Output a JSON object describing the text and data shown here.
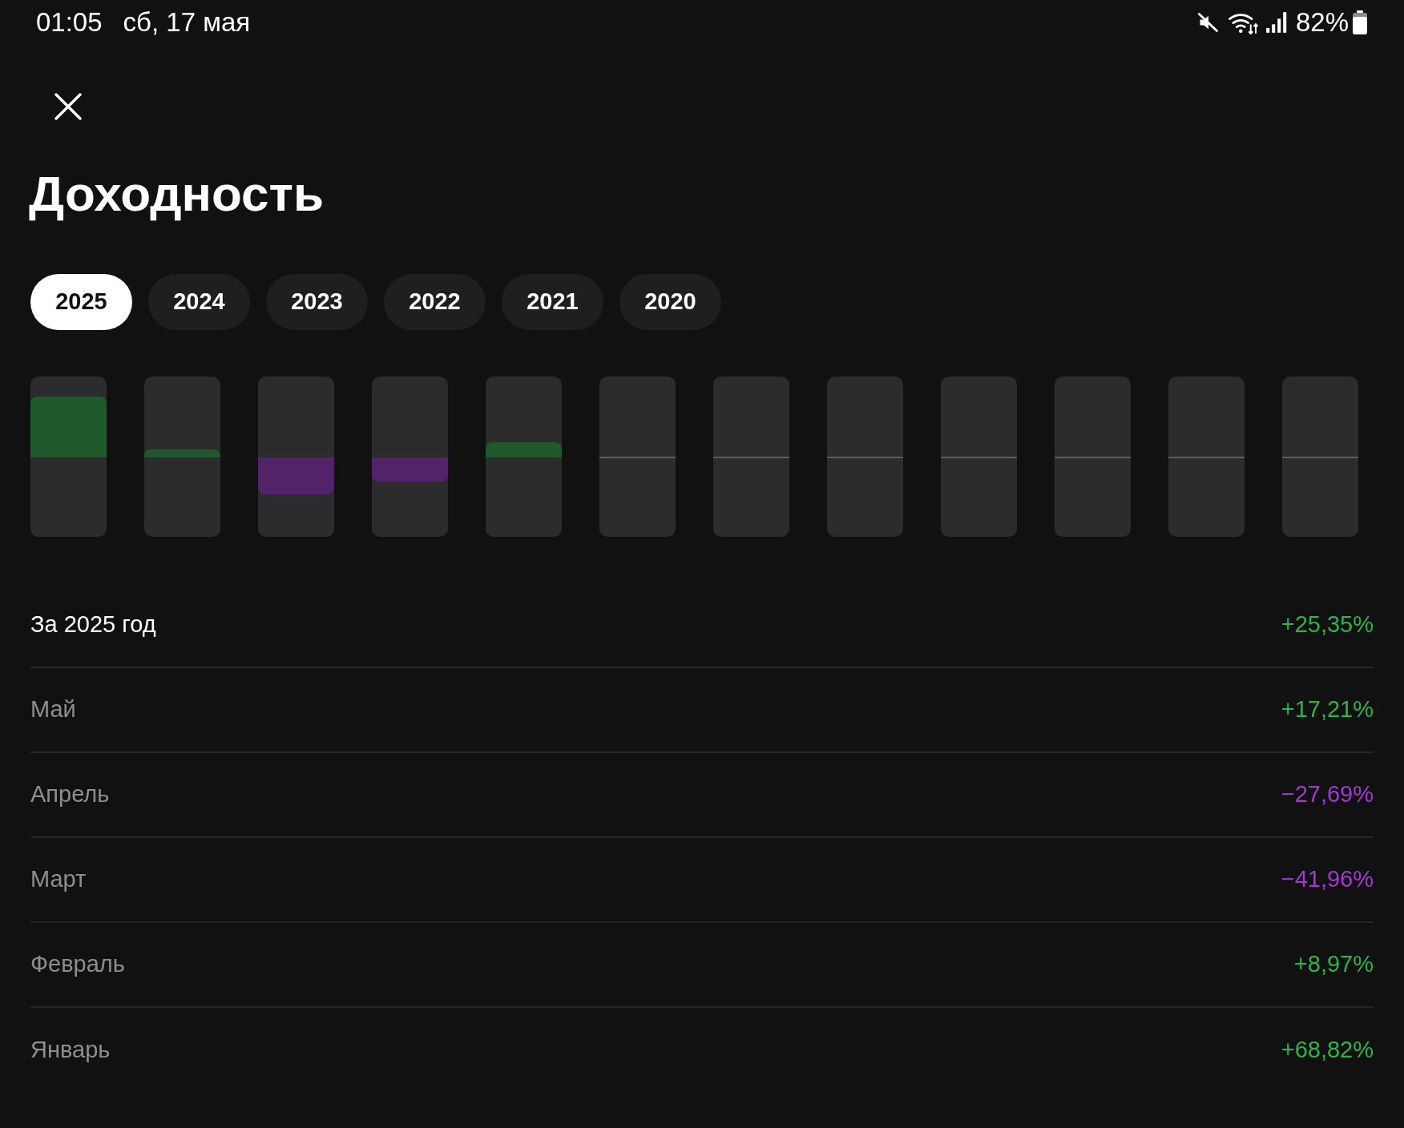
{
  "status_bar": {
    "time": "01:05",
    "date": "сб, 17 мая",
    "battery": "82%"
  },
  "screen": {
    "title": "Доходность"
  },
  "years": [
    {
      "label": "2025",
      "selected": true
    },
    {
      "label": "2024",
      "selected": false
    },
    {
      "label": "2023",
      "selected": false
    },
    {
      "label": "2022",
      "selected": false
    },
    {
      "label": "2021",
      "selected": false
    },
    {
      "label": "2020",
      "selected": false
    }
  ],
  "rows": [
    {
      "kind": "total",
      "label": "За 2025 год",
      "value": "+25,35%",
      "color": "#2fb24c"
    },
    {
      "kind": "month",
      "label": "Май",
      "value": "+17,21%",
      "color": "#2fb24c"
    },
    {
      "kind": "month",
      "label": "Апрель",
      "value": "−27,69%",
      "color": "#a338d6"
    },
    {
      "kind": "month",
      "label": "Март",
      "value": "−41,96%",
      "color": "#a338d6"
    },
    {
      "kind": "month",
      "label": "Февраль",
      "value": "+8,97%",
      "color": "#2fb24c"
    },
    {
      "kind": "month",
      "label": "Январь",
      "value": "+68,82%",
      "color": "#2fb24c"
    }
  ]
}
